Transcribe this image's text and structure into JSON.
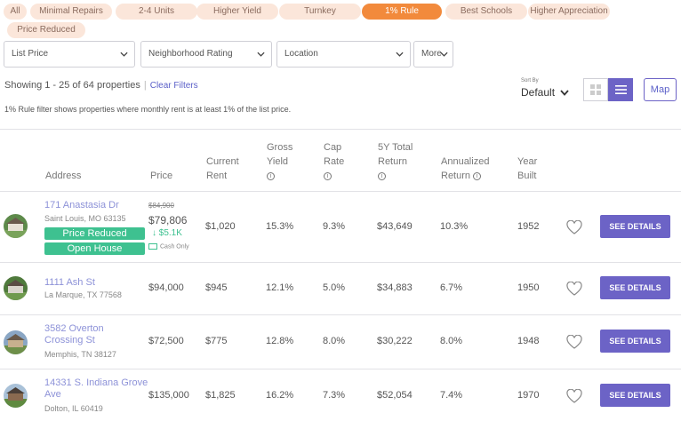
{
  "filters": {
    "chips": [
      {
        "label": "All",
        "active": false
      },
      {
        "label": "Minimal Repairs",
        "active": false
      },
      {
        "label": "2-4 Units",
        "active": false
      },
      {
        "label": "Higher Yield",
        "active": false
      },
      {
        "label": "Turnkey",
        "active": false
      },
      {
        "label": "1% Rule",
        "active": true
      },
      {
        "label": "Best Schools",
        "active": false
      },
      {
        "label": "Higher Appreciation",
        "active": false
      },
      {
        "label": "Price Reduced",
        "active": false
      }
    ],
    "dropdowns": {
      "list_price": "List Price",
      "neighborhood": "Neighborhood Rating",
      "location": "Location",
      "more": "More"
    }
  },
  "results": {
    "showing": "Showing 1 - 25 of 64 properties",
    "separator": "|",
    "clear_filters": "Clear Filters",
    "note": "1% Rule filter shows properties where monthly rent is at least 1% of the list price."
  },
  "sort": {
    "label": "Sort By",
    "value": "Default"
  },
  "view": {
    "map_label": "Map",
    "active": "list"
  },
  "table": {
    "headers": {
      "address": "Address",
      "price": "Price",
      "current_rent": [
        "Current",
        "Rent"
      ],
      "gross_yield": [
        "Gross",
        "Yield"
      ],
      "cap_rate": [
        "Cap",
        "Rate"
      ],
      "total_return": [
        "5Y Total",
        "Return"
      ],
      "annualized_return": [
        "Annualized",
        "Return"
      ],
      "year_built": [
        "Year",
        "Built"
      ]
    },
    "info_glyph": "i",
    "details_label": "SEE DETAILS",
    "rows": [
      {
        "address_line1": "171 Anastasia Dr",
        "address_line2": "Saint Louis, MO 63135",
        "original_price": "$84,900",
        "price": "$79,806",
        "price_drop": "$5.1K",
        "cash_only": "Cash Only",
        "tags": [
          "Price Reduced",
          "Open House"
        ],
        "rent": "$1,020",
        "gross_yield": "15.3%",
        "cap_rate": "9.3%",
        "total_return": "$43,649",
        "annualized": "10.3%",
        "year": "1952"
      },
      {
        "address_line1": "1111 Ash St",
        "address_line2": "La Marque, TX 77568",
        "price": "$94,000",
        "rent": "$945",
        "gross_yield": "12.1%",
        "cap_rate": "5.0%",
        "total_return": "$34,883",
        "annualized": "6.7%",
        "year": "1950"
      },
      {
        "address_line1": "3582 Overton",
        "address_line1b": "Crossing St",
        "address_line2": "Memphis, TN 38127",
        "price": "$72,500",
        "rent": "$775",
        "gross_yield": "12.8%",
        "cap_rate": "8.0%",
        "total_return": "$30,222",
        "annualized": "8.0%",
        "year": "1948"
      },
      {
        "address_line1": "14331 S. Indiana Grove",
        "address_line1b": "Ave",
        "address_line2": "Dolton, IL 60419",
        "price": "$135,000",
        "rent": "$1,825",
        "gross_yield": "16.2%",
        "cap_rate": "7.3%",
        "total_return": "$52,054",
        "annualized": "7.4%",
        "year": "1970"
      }
    ]
  },
  "colors": {
    "accent": "#6c63c6",
    "chip": "#fbe6da",
    "chip_active": "#f28a3c",
    "green_tag": "#3ec190",
    "link": "#5a5fc8"
  }
}
